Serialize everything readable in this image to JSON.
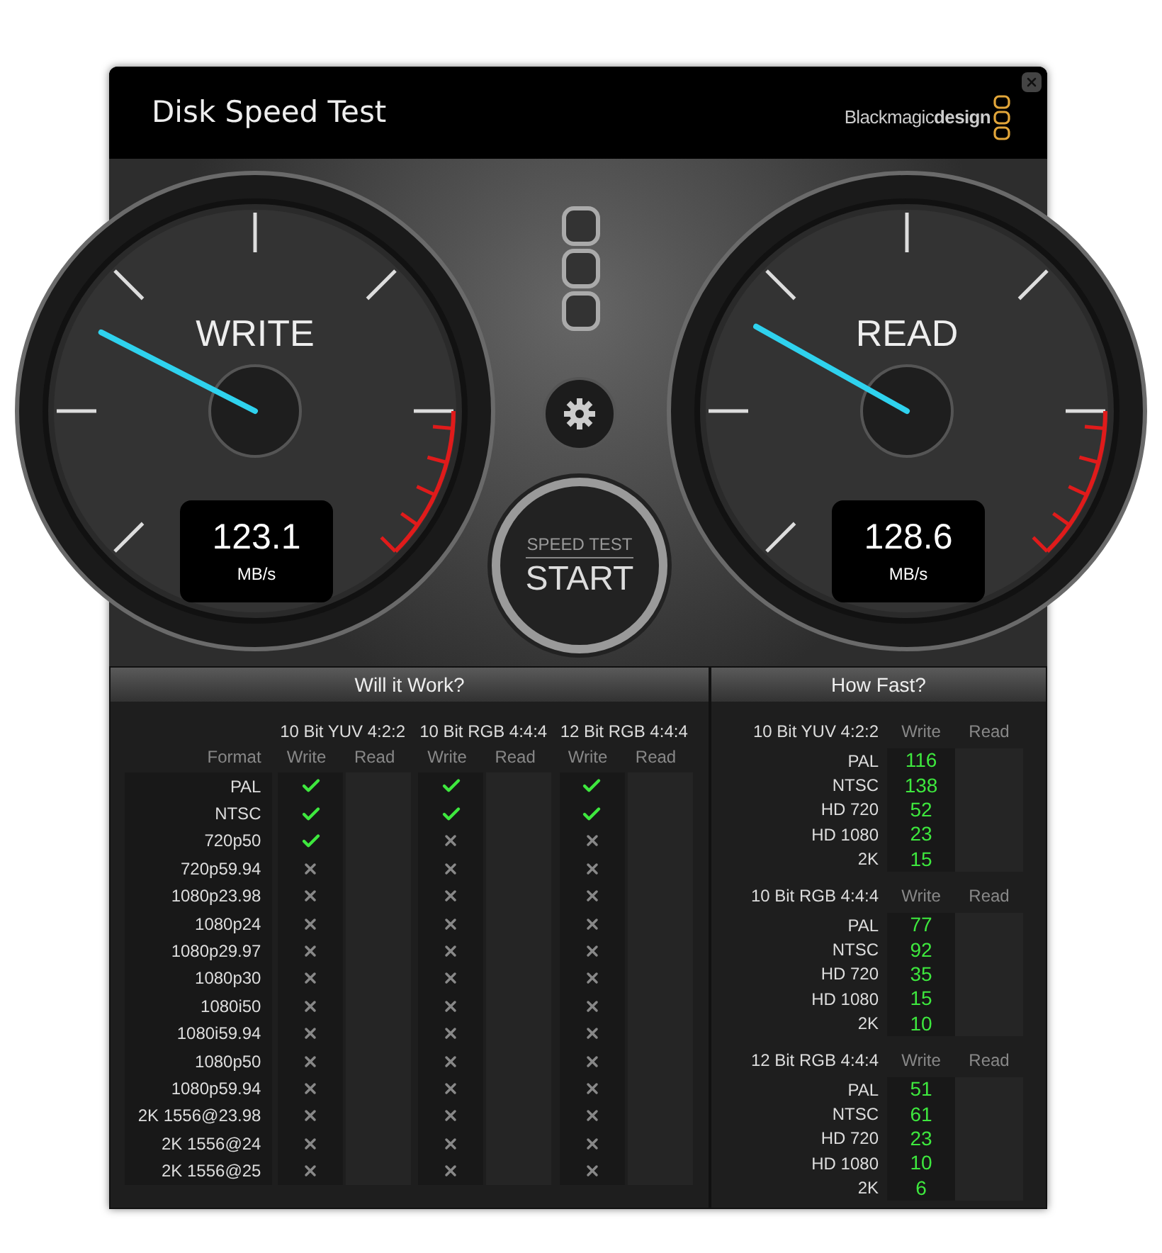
{
  "window": {
    "title": "Disk Speed Test",
    "logo": "Blackmagic**design**"
  },
  "gauges": [
    {
      "label": "WRITE",
      "value": "123.1",
      "unit": "MB/s",
      "level": 0.267
    },
    {
      "label": "READ",
      "value": "128.6",
      "unit": "MB/s",
      "level": 0.275
    }
  ],
  "start_button": {
    "caption": "SPEED TEST",
    "label": "START"
  },
  "will_it_work": {
    "title": "Will it Work?",
    "format_header": "Format",
    "groups": [
      {
        "name": "10 Bit YUV 4:2:2",
        "write_header": "Write",
        "read_header": "Read"
      },
      {
        "name": "10 Bit RGB 4:4:4",
        "write_header": "Write",
        "read_header": "Read"
      },
      {
        "name": "12 Bit RGB 4:4:4",
        "write_header": "Write",
        "read_header": "Read"
      }
    ],
    "rows": [
      {
        "format": "PAL",
        "write": [
          true,
          true,
          true
        ]
      },
      {
        "format": "NTSC",
        "write": [
          true,
          true,
          true
        ]
      },
      {
        "format": "720p50",
        "write": [
          true,
          false,
          false
        ]
      },
      {
        "format": "720p59.94",
        "write": [
          false,
          false,
          false
        ]
      },
      {
        "format": "1080p23.98",
        "write": [
          false,
          false,
          false
        ]
      },
      {
        "format": "1080p24",
        "write": [
          false,
          false,
          false
        ]
      },
      {
        "format": "1080p29.97",
        "write": [
          false,
          false,
          false
        ]
      },
      {
        "format": "1080p30",
        "write": [
          false,
          false,
          false
        ]
      },
      {
        "format": "1080i50",
        "write": [
          false,
          false,
          false
        ]
      },
      {
        "format": "1080i59.94",
        "write": [
          false,
          false,
          false
        ]
      },
      {
        "format": "1080p50",
        "write": [
          false,
          false,
          false
        ]
      },
      {
        "format": "1080p59.94",
        "write": [
          false,
          false,
          false
        ]
      },
      {
        "format": "2K 1556@23.98",
        "write": [
          false,
          false,
          false
        ]
      },
      {
        "format": "2K 1556@24",
        "write": [
          false,
          false,
          false
        ]
      },
      {
        "format": "2K 1556@25",
        "write": [
          false,
          false,
          false
        ]
      }
    ]
  },
  "how_fast": {
    "title": "How Fast?",
    "sections": [
      {
        "name": "10 Bit YUV 4:2:2",
        "write_header": "Write",
        "read_header": "Read",
        "rows": [
          {
            "format": "PAL",
            "write": "116"
          },
          {
            "format": "NTSC",
            "write": "138"
          },
          {
            "format": "HD 720",
            "write": "52"
          },
          {
            "format": "HD 1080",
            "write": "23"
          },
          {
            "format": "2K",
            "write": "15"
          }
        ]
      },
      {
        "name": "10 Bit RGB 4:4:4",
        "write_header": "Write",
        "read_header": "Read",
        "rows": [
          {
            "format": "PAL",
            "write": "77"
          },
          {
            "format": "NTSC",
            "write": "92"
          },
          {
            "format": "HD 720",
            "write": "35"
          },
          {
            "format": "HD 1080",
            "write": "15"
          },
          {
            "format": "2K",
            "write": "10"
          }
        ]
      },
      {
        "name": "12 Bit RGB 4:4:4",
        "write_header": "Write",
        "read_header": "Read",
        "rows": [
          {
            "format": "PAL",
            "write": "51"
          },
          {
            "format": "NTSC",
            "write": "61"
          },
          {
            "format": "HD 720",
            "write": "23"
          },
          {
            "format": "HD 1080",
            "write": "10"
          },
          {
            "format": "2K",
            "write": "6"
          }
        ]
      }
    ]
  }
}
